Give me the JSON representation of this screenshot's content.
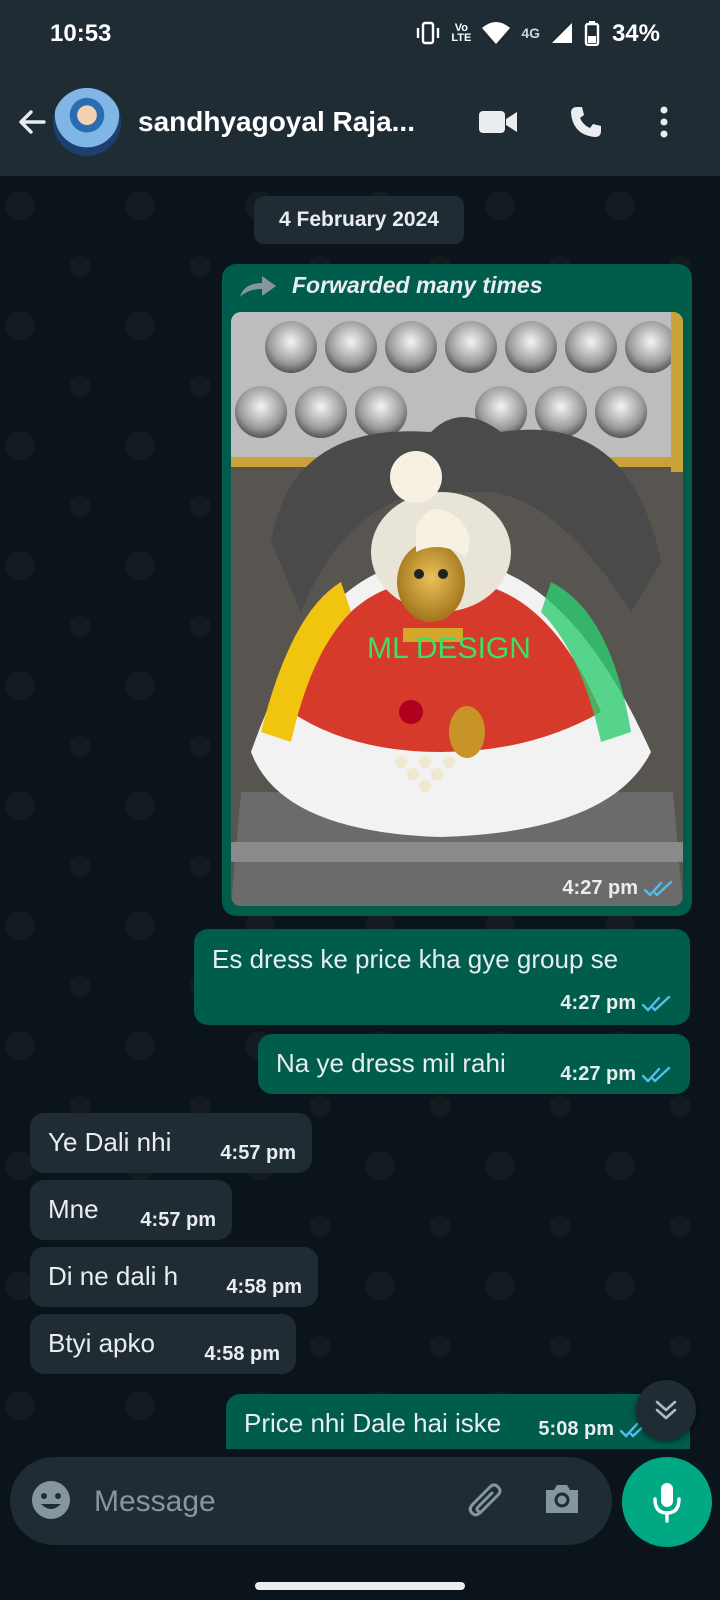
{
  "status_bar": {
    "time": "10:53",
    "network_label_top": "Vo",
    "network_label_bottom": "LTE",
    "network_type": "4G",
    "battery": "34%",
    "icons": [
      "vibrate-icon",
      "volte-icon",
      "wifi-icon",
      "signal-icon",
      "battery-icon"
    ]
  },
  "header": {
    "contact_name": "sandhyagoyal Raja...",
    "icons": [
      "back-arrow-icon",
      "avatar",
      "video-call-icon",
      "phone-icon",
      "more-vert-icon"
    ]
  },
  "chat": {
    "date_chip": "4 February 2024",
    "forwarded_label": "Forwarded many times",
    "photo_watermark": "ML DESIGN",
    "photo_time": "4:27 pm",
    "outgoing": [
      {
        "text": "Es dress ke price kha gye group se",
        "time": "4:27 pm",
        "status": "read"
      },
      {
        "text": "Na ye dress mil rahi",
        "time": "4:27 pm",
        "status": "read"
      }
    ],
    "incoming": [
      {
        "text": "Ye Dali nhi",
        "time": "4:57 pm"
      },
      {
        "text": "Mne",
        "time": "4:57 pm"
      },
      {
        "text": "Di ne dali h",
        "time": "4:58 pm"
      },
      {
        "text": "Btyi apko",
        "time": "4:58 pm"
      }
    ],
    "last_outgoing": {
      "text": "Price nhi Dale hai iske",
      "time": "5:08 pm",
      "status": "read"
    }
  },
  "input_bar": {
    "placeholder": "Message",
    "icons": [
      "emoji-icon",
      "attach-icon",
      "camera-icon",
      "mic-icon"
    ]
  },
  "colors": {
    "background": "#0b141a",
    "header": "#1f2c34",
    "outgoing_bubble": "#005c4b",
    "incoming_bubble": "#202c33",
    "accent": "#00a884",
    "read_tick": "#53bdeb"
  }
}
